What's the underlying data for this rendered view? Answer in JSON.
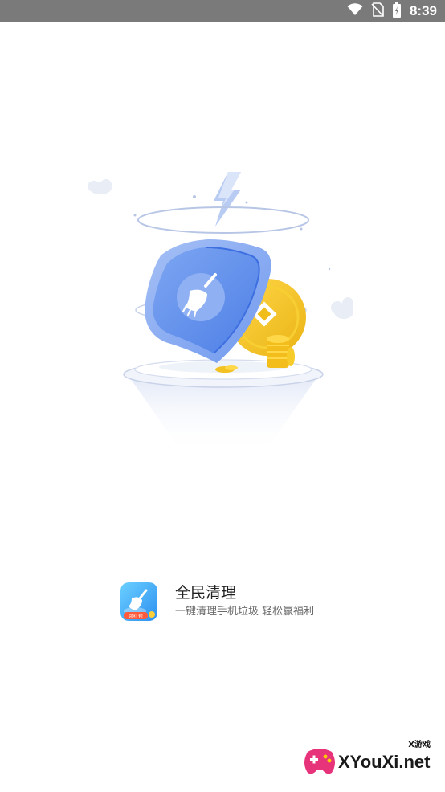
{
  "status_bar": {
    "time": "8:39",
    "icons": [
      "wifi-icon",
      "no-sim-icon",
      "battery-icon"
    ]
  },
  "app": {
    "name": "全民清理",
    "slogan": "一键清理手机垃圾 轻松赢福利",
    "icon_badge": "领红包",
    "icon_name": "broom-app-icon"
  },
  "illustration": {
    "subject": "shield-with-broom-and-coins",
    "colors": {
      "shield": "#5b8df0",
      "shield_light": "#a9c3f7",
      "coin": "#f5c423",
      "ring": "#b8c6e6"
    }
  },
  "watermark": {
    "text": "XYouXi.net",
    "tag": "X游戏"
  },
  "colors": {
    "status_bar_bg": "#7a7a7a",
    "background": "#ffffff"
  }
}
